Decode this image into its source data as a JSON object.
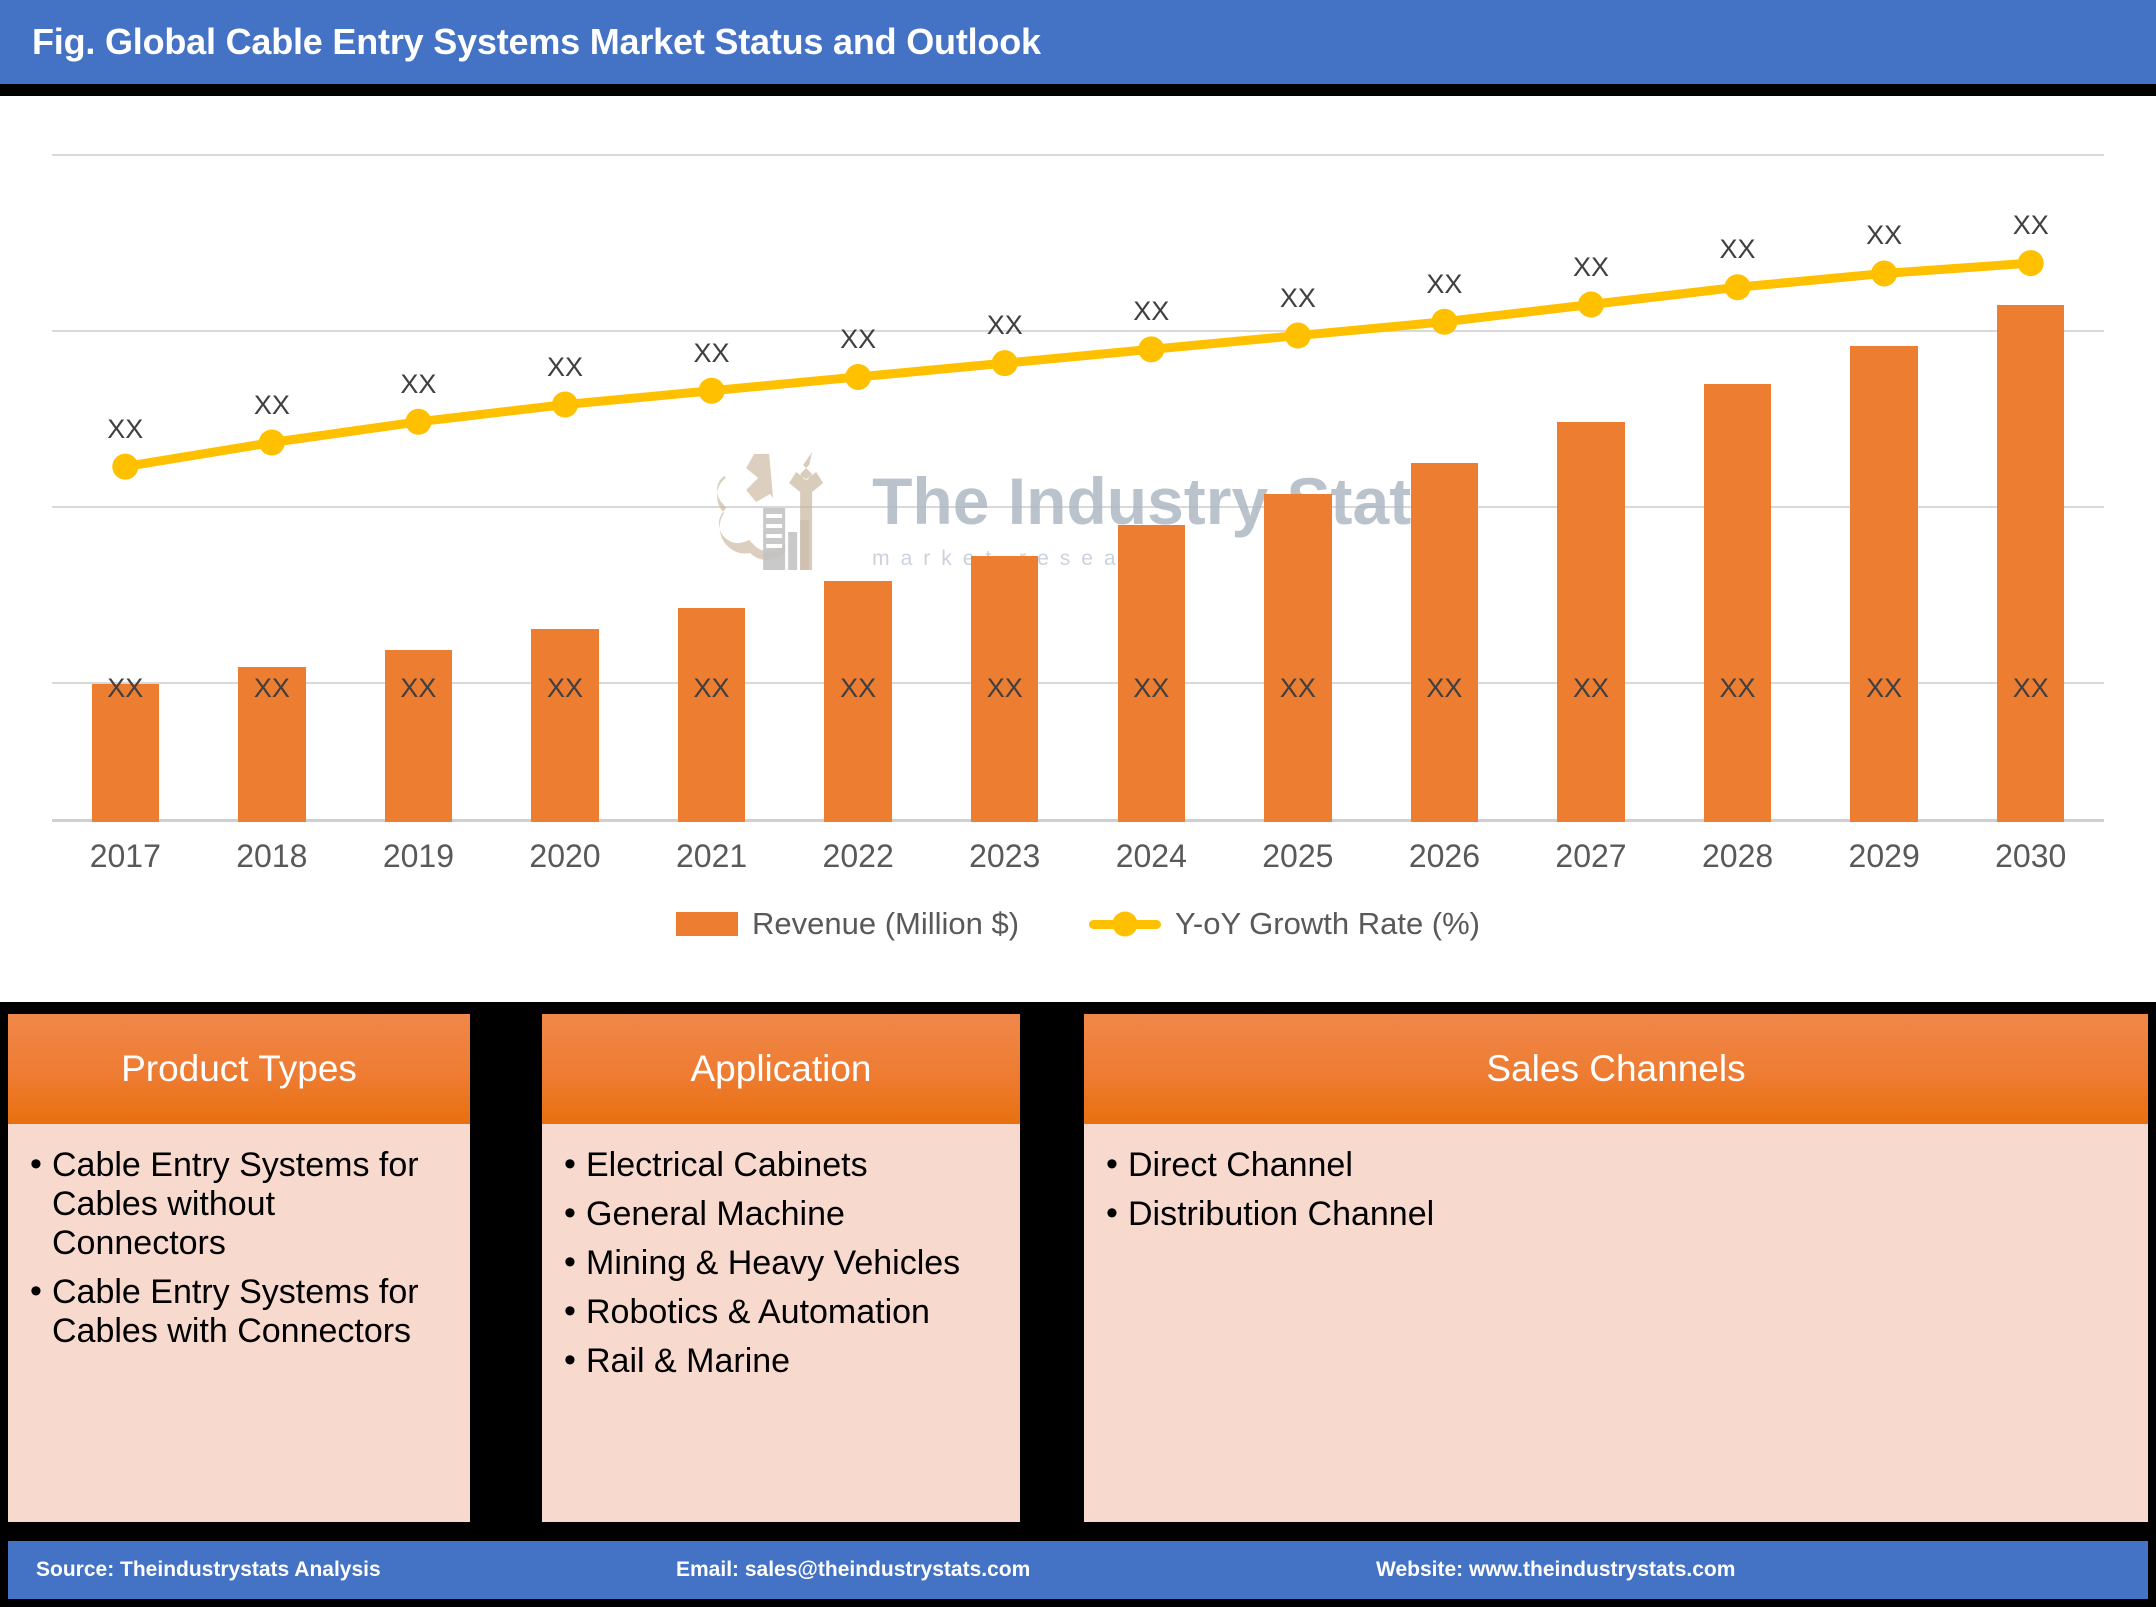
{
  "title": "Fig. Global Cable Entry Systems Market Status and Outlook",
  "watermark": {
    "main": "The Industry Stats",
    "sub": "market research"
  },
  "chart_data": {
    "type": "bar",
    "title": "Fig. Global Cable Entry Systems Market Status and Outlook",
    "xlabel": "",
    "ylabel": "",
    "grid": true,
    "legend_position": "bottom",
    "categories": [
      "2017",
      "2018",
      "2019",
      "2020",
      "2021",
      "2022",
      "2023",
      "2024",
      "2025",
      "2026",
      "2027",
      "2028",
      "2029",
      "2030"
    ],
    "series": [
      {
        "name": "Revenue (Million $)",
        "type": "bar",
        "color": "#ED7D31",
        "values": [
          40,
          45,
          50,
          56,
          62,
          70,
          77,
          86,
          95,
          104,
          116,
          127,
          138,
          150
        ],
        "data_labels": [
          "XX",
          "XX",
          "XX",
          "XX",
          "XX",
          "XX",
          "XX",
          "XX",
          "XX",
          "XX",
          "XX",
          "XX",
          "XX",
          "XX"
        ],
        "label_position": "inside-end"
      },
      {
        "name": "Y-oY Growth Rate (%)",
        "type": "line",
        "color": "#FFC000",
        "values": [
          103,
          110,
          116,
          121,
          125,
          129,
          133,
          137,
          141,
          145,
          150,
          155,
          159,
          162
        ],
        "data_labels": [
          "XX",
          "XX",
          "XX",
          "XX",
          "XX",
          "XX",
          "XX",
          "XX",
          "XX",
          "XX",
          "XX",
          "XX",
          "XX",
          "XX"
        ],
        "label_position": "above"
      }
    ],
    "ylim": [
      0,
      200
    ],
    "gridline_values": [
      50,
      100,
      150,
      200
    ]
  },
  "legend": [
    {
      "label": "Revenue (Million $)",
      "marker": "square",
      "color": "#ED7D31"
    },
    {
      "label": "Y-oY Growth Rate (%)",
      "marker": "line-dot",
      "color": "#FFC000"
    }
  ],
  "panels": [
    {
      "heading": "Product Types",
      "items": [
        "Cable Entry Systems for Cables without Connectors",
        "Cable Entry Systems for Cables with Connectors"
      ]
    },
    {
      "heading": "Application",
      "items": [
        "Electrical Cabinets",
        "General Machine",
        "Mining & Heavy Vehicles",
        "Robotics & Automation",
        "Rail & Marine"
      ]
    },
    {
      "heading": "Sales Channels",
      "items": [
        "Direct Channel",
        "Distribution Channel"
      ]
    }
  ],
  "footer": {
    "source": "Source: Theindustrystats Analysis",
    "email": "Email: sales@theindustrystats.com",
    "website": "Website: www.theindustrystats.com"
  },
  "colors": {
    "title_bar": "#4472C4",
    "bar": "#ED7D31",
    "line": "#FFC000",
    "panel_head": "#ED7D31",
    "panel_body": "#F8D9CD",
    "background": "#000000"
  }
}
